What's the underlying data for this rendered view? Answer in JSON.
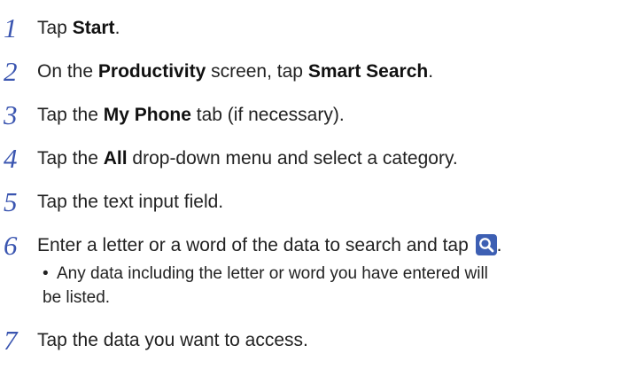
{
  "steps": [
    {
      "num": "1",
      "t1": "Tap ",
      "b1": "Start",
      "t2": "."
    },
    {
      "num": "2",
      "t1": "On the ",
      "b1": "Productivity",
      "t2": " screen, tap ",
      "b2": "Smart Search",
      "t3": "."
    },
    {
      "num": "3",
      "t1": "Tap the ",
      "b1": "My Phone",
      "t2": " tab (if necessary)."
    },
    {
      "num": "4",
      "t1": "Tap the ",
      "b1": "All",
      "t2": " drop-down menu and select a category."
    },
    {
      "num": "5",
      "t1": "Tap the text input field."
    },
    {
      "num": "6",
      "t1": "Enter a letter or a word of the data to search and tap ",
      "t2": "."
    },
    {
      "num": "7",
      "t1": "Tap the data you want to access."
    }
  ],
  "bullet": {
    "dot": "•",
    "line1": "Any data including the letter or word you have entered will",
    "line2": "be listed."
  },
  "icons": {
    "search": "search-icon"
  },
  "colors": {
    "step_number": "#3a55b0",
    "search_icon_bg": "#3d5fb3"
  }
}
